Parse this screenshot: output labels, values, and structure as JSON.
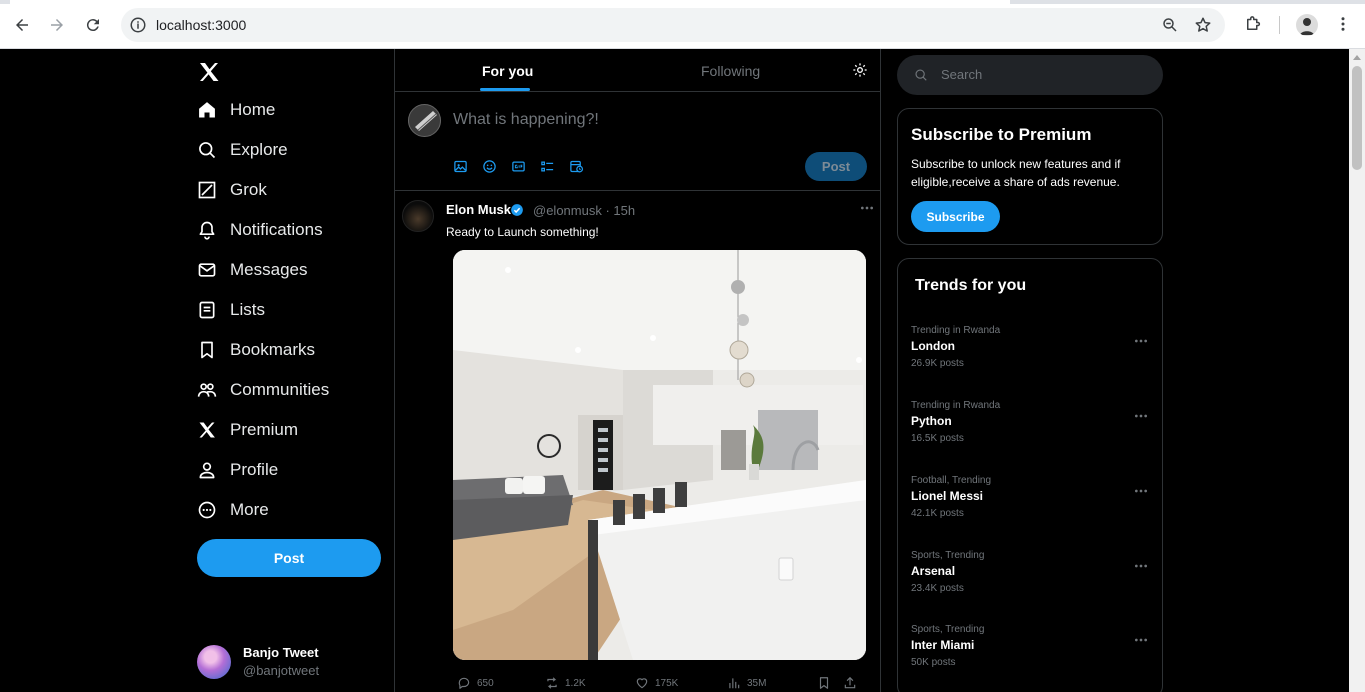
{
  "browser": {
    "url": "localhost:3000"
  },
  "nav": {
    "items": [
      {
        "label": "Home",
        "icon": "home-icon"
      },
      {
        "label": "Explore",
        "icon": "search-icon"
      },
      {
        "label": "Grok",
        "icon": "grok-icon"
      },
      {
        "label": "Notifications",
        "icon": "bell-icon"
      },
      {
        "label": "Messages",
        "icon": "mail-icon"
      },
      {
        "label": "Lists",
        "icon": "list-icon"
      },
      {
        "label": "Bookmarks",
        "icon": "bookmark-icon"
      },
      {
        "label": "Communities",
        "icon": "communities-icon"
      },
      {
        "label": "Premium",
        "icon": "x-icon"
      },
      {
        "label": "Profile",
        "icon": "user-icon"
      },
      {
        "label": "More",
        "icon": "more-circle-icon"
      }
    ],
    "post_label": "Post",
    "profile": {
      "name": "Banjo Tweet",
      "handle": "@banjotweet"
    }
  },
  "feed": {
    "tabs": [
      "For you",
      "Following"
    ],
    "composer": {
      "placeholder": "What is happening?!",
      "post_label": "Post"
    },
    "tweet": {
      "name": "Elon Musk",
      "handle": "@elonmusk",
      "time": "15h",
      "text": "Ready to Launch something!",
      "stats": {
        "replies": "650",
        "retweets": "1.2K",
        "likes": "175K",
        "views": "35M"
      }
    }
  },
  "sidebar": {
    "search_placeholder": "Search",
    "premium": {
      "title": "Subscribe to Premium",
      "description": "Subscribe to unlock new features and if eligible,receive a share of ads revenue.",
      "button": "Subscribe"
    },
    "trends_title": "Trends for you",
    "trends": [
      {
        "context": "Trending in Rwanda",
        "title": "London",
        "count": "26.9K posts"
      },
      {
        "context": "Trending in Rwanda",
        "title": "Python",
        "count": "16.5K posts"
      },
      {
        "context": "Football, Trending",
        "title": "Lionel Messi",
        "count": "42.1K posts"
      },
      {
        "context": "Sports, Trending",
        "title": "Arsenal",
        "count": "23.4K posts"
      },
      {
        "context": "Sports, Trending",
        "title": "Inter Miami",
        "count": "50K posts"
      }
    ]
  },
  "colors": {
    "accent": "#1d9bf0",
    "background": "#000000",
    "border": "#2f3336",
    "muted": "#71767b"
  }
}
